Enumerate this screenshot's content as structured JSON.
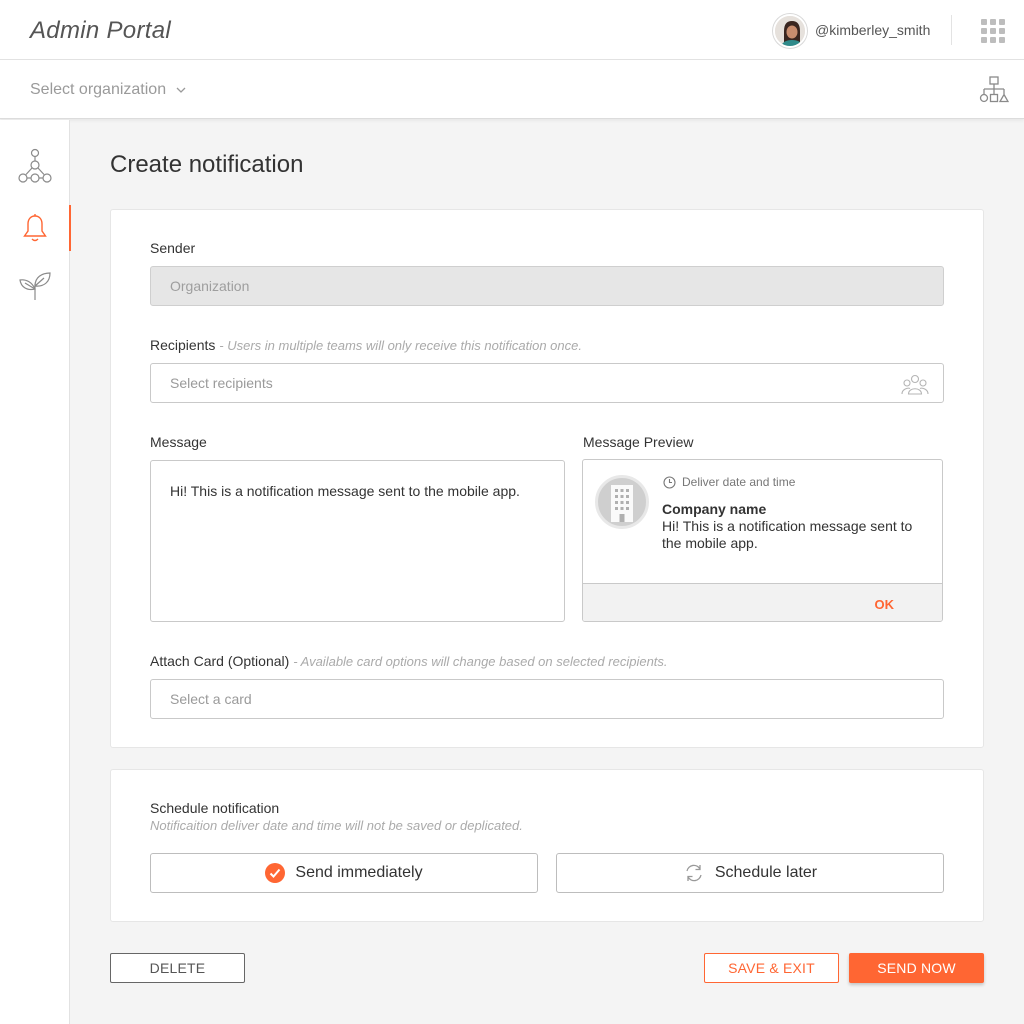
{
  "header": {
    "app_title": "Admin Portal",
    "username": "@kimberley_smith",
    "apps_icon": "apps-grid-icon"
  },
  "org_bar": {
    "select_label": "Select organization",
    "org_chart_icon": "org-chart-icon"
  },
  "sidebar": {
    "items": [
      {
        "icon": "network-icon",
        "active": false
      },
      {
        "icon": "bell-icon",
        "active": true
      },
      {
        "icon": "leaf-icon",
        "active": false
      }
    ]
  },
  "page": {
    "title": "Create notification"
  },
  "form": {
    "sender_label": "Sender",
    "sender_value": "Organization",
    "recipients_label": "Recipients",
    "recipients_hint": "- Users in multiple teams will only receive this notification once.",
    "recipients_placeholder": "Select recipients",
    "message_label": "Message",
    "message_value": "Hi! This is a notification message sent to the mobile app.",
    "preview_label": "Message Preview",
    "preview": {
      "deliver_label": "Deliver date and time",
      "company": "Company name",
      "text": "Hi! This is a notification message sent to the mobile app.",
      "ok_label": "OK"
    },
    "attach_label": "Attach Card (Optional)",
    "attach_hint": "- Available card options will change based on  selected recipients.",
    "attach_placeholder": "Select a card"
  },
  "schedule": {
    "title": "Schedule notification",
    "subtitle": "Notificaition deliver date and time will not be saved or deplicated.",
    "send_immediately": "Send immediately",
    "schedule_later": "Schedule later",
    "selected": "send_immediately"
  },
  "actions": {
    "delete": "DELETE",
    "save_exit": "SAVE & EXIT",
    "send_now": "SEND NOW"
  },
  "colors": {
    "accent": "#ff6633",
    "border": "#c9c9c9",
    "background": "#f4f4f4"
  }
}
